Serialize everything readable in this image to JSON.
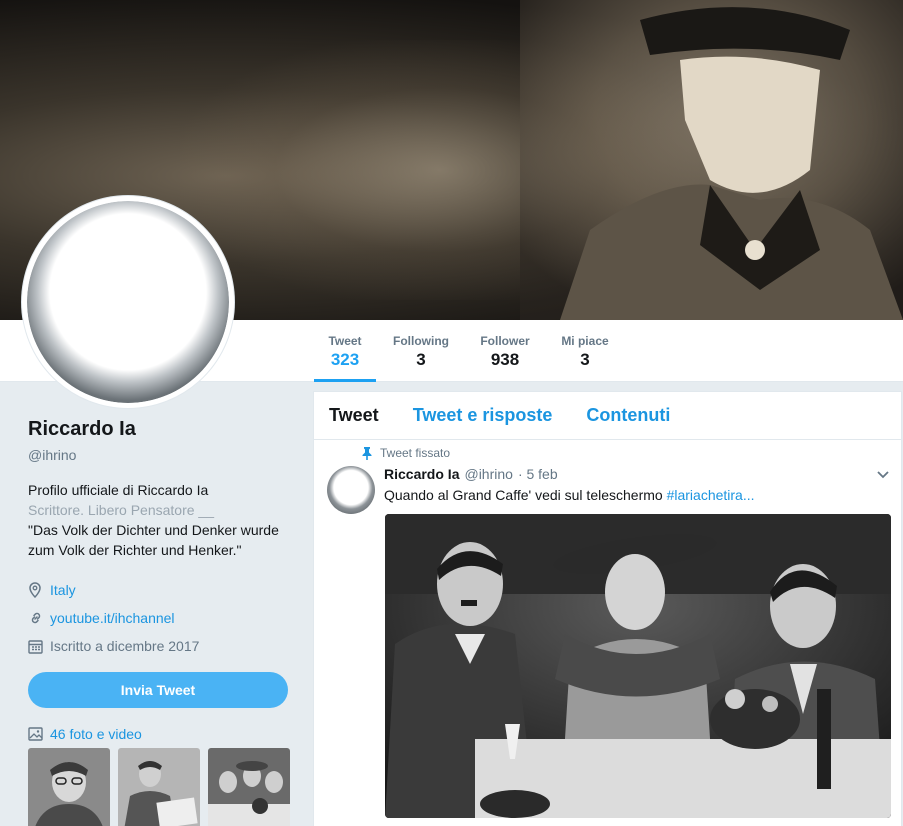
{
  "stats": [
    {
      "label": "Tweet",
      "value": "323"
    },
    {
      "label": "Following",
      "value": "3"
    },
    {
      "label": "Follower",
      "value": "938"
    },
    {
      "label": "Mi piace",
      "value": "3"
    }
  ],
  "profile": {
    "name": "Riccardo Ia",
    "handle": "@ihrino",
    "bio_lines": [
      "Profilo ufficiale di Riccardo Ia",
      "Scrittore. Libero Pensatore __",
      "\"Das Volk der Dichter und Denker wurde",
      "zum Volk der Richter und Henker.\""
    ],
    "location": "Italy",
    "website": "youtube.it/ihchannel",
    "joined": "Iscritto a dicembre 2017",
    "tweet_button": "Invia Tweet",
    "media_label": "46 foto e video"
  },
  "tabs": [
    "Tweet",
    "Tweet e risposte",
    "Contenuti"
  ],
  "tweet": {
    "pinned_label": "Tweet fissato",
    "name": "Riccardo Ia",
    "handle": "@ihrino",
    "date": "· 5 feb",
    "text": "Quando al Grand Caffe' vedi sul teleschermo ",
    "hashtag": "#lariachetira..."
  },
  "colors": {
    "accent": "#1da1f2",
    "link": "#1b95e0",
    "button": "#4ab3f4",
    "muted": "#657786",
    "background": "#e6ecf0"
  },
  "icons": [
    "location-icon",
    "link-icon",
    "calendar-icon",
    "photo-icon",
    "pin-icon",
    "chevron-down-icon"
  ]
}
